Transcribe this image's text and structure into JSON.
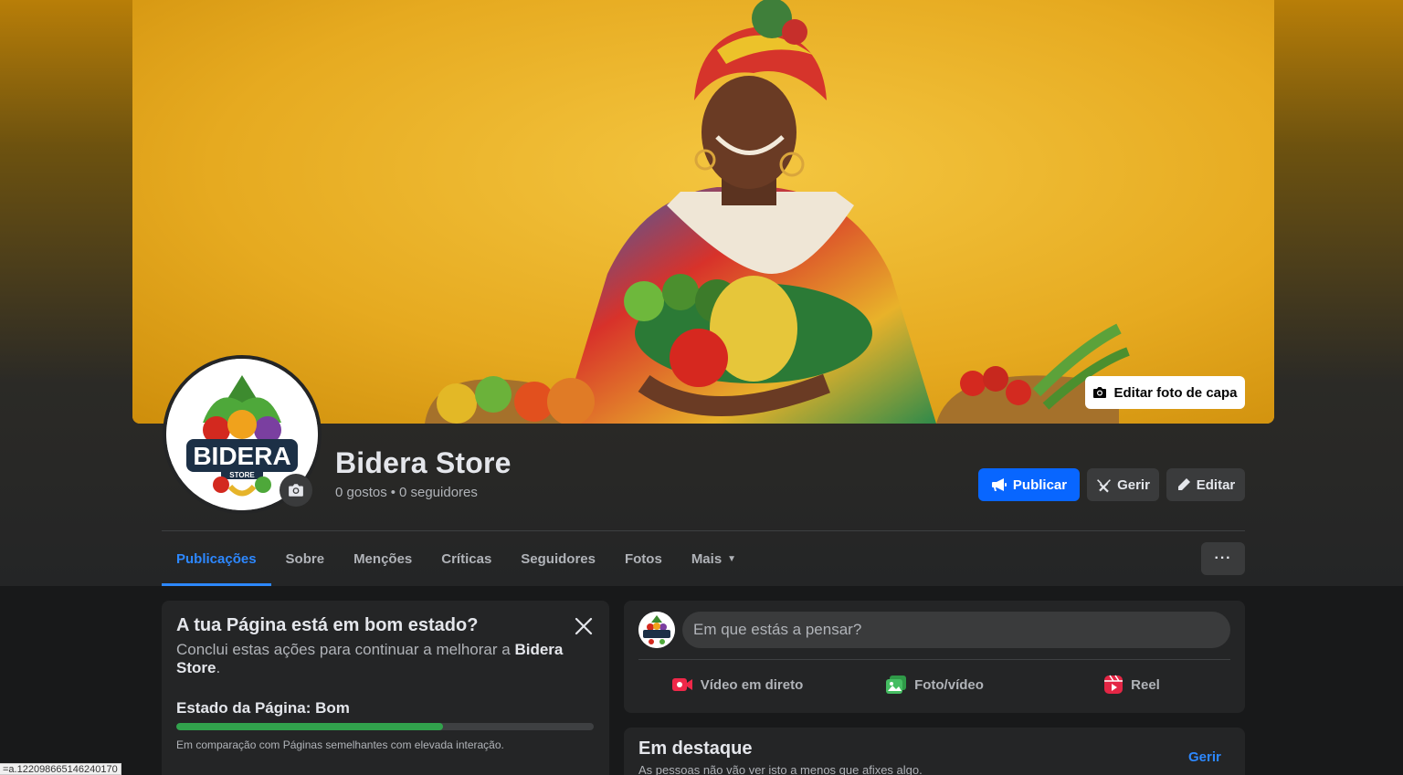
{
  "cover": {
    "edit_label": "Editar foto de capa"
  },
  "page": {
    "name": "Bidera Store",
    "likes": "0 gostos",
    "separator": "•",
    "followers": "0 seguidores",
    "logo_text": "BIDERA",
    "logo_subtext": "STORE"
  },
  "actions": {
    "publish_label": "Publicar",
    "manage_label": "Gerir",
    "edit_label": "Editar"
  },
  "tabs": [
    {
      "label": "Publicações",
      "active": true
    },
    {
      "label": "Sobre"
    },
    {
      "label": "Menções"
    },
    {
      "label": "Críticas"
    },
    {
      "label": "Seguidores"
    },
    {
      "label": "Fotos"
    },
    {
      "label": "Mais"
    }
  ],
  "more_button": "···",
  "health": {
    "title": "A tua Página está em bom estado?",
    "desc_prefix": "Conclui estas ações para continuar a melhorar a ",
    "desc_name": "Bidera Store",
    "desc_suffix": ".",
    "status": "Estado da Página: Bom",
    "progress": 0.64,
    "compare": "Em comparação com Páginas semelhantes com elevada interação."
  },
  "composer": {
    "placeholder": "Em que estás a pensar?",
    "actions": [
      {
        "label": "Vídeo em direto",
        "icon": "live-video-icon",
        "color": "#f02849"
      },
      {
        "label": "Foto/vídeo",
        "icon": "photo-video-icon",
        "color": "#45bd62"
      },
      {
        "label": "Reel",
        "icon": "reel-icon",
        "color": "#e42645"
      }
    ]
  },
  "featured": {
    "title": "Em destaque",
    "subtitle": "As pessoas não vão ver isto a menos que afixes algo.",
    "manage_label": "Gerir"
  },
  "status_bar": {
    "url": "=a.122098665146240170"
  },
  "colors": {
    "accent": "#0866ff",
    "link": "#2d88ff",
    "progress": "#31a24c"
  }
}
